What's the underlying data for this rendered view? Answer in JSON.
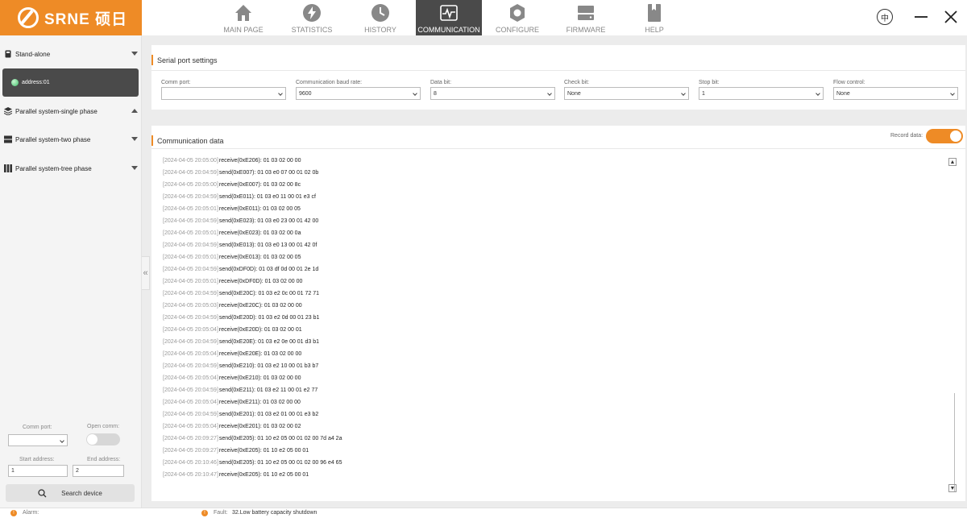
{
  "app": {
    "brand": "SRNE 硕日"
  },
  "nav": [
    {
      "label": "MAIN PAGE",
      "icon": "home-icon"
    },
    {
      "label": "STATISTICS",
      "icon": "bolt-icon"
    },
    {
      "label": "HISTORY",
      "icon": "clock-icon"
    },
    {
      "label": "COMMUNICATION",
      "icon": "pulse-icon",
      "active": true
    },
    {
      "label": "CONFIGURE",
      "icon": "gear-icon"
    },
    {
      "label": "FIRMWARE",
      "icon": "drive-icon"
    },
    {
      "label": "HELP",
      "icon": "book-icon"
    }
  ],
  "window": {
    "lang": "中"
  },
  "sidebar": {
    "items": [
      {
        "label": "Stand-alone"
      },
      {
        "label": "Parallel system-single phase"
      },
      {
        "label": "Parallel system-two phase"
      },
      {
        "label": "Parallel system-tree phase"
      }
    ],
    "address": "address:01",
    "comm_port_label": "Comm port:",
    "comm_port_value": "",
    "open_comm_label": "Open comm:",
    "start_address_label": "Start address:",
    "start_address_value": "1",
    "end_address_label": "End address:",
    "end_address_value": "2",
    "search_label": "Search device"
  },
  "serial": {
    "title": "Serial port settings",
    "fields": [
      {
        "label": "Comm port:",
        "value": ""
      },
      {
        "label": "Communication baud rate:",
        "value": "9600"
      },
      {
        "label": "Data bit:",
        "value": "8"
      },
      {
        "label": "Check bit:",
        "value": "None"
      },
      {
        "label": "Stop bit:",
        "value": "1"
      },
      {
        "label": "Flow control:",
        "value": "None"
      }
    ]
  },
  "comm": {
    "title": "Communication data",
    "record_label": "Record data:",
    "log": [
      {
        "ts": "[2024-04-05 20:05:00]",
        "msg": "receive(0xE206): 01 03 02 00 00"
      },
      {
        "ts": "[2024-04-05 20:04:59]",
        "msg": "send(0xE007): 01 03 e0 07 00 01 02 0b"
      },
      {
        "ts": "[2024-04-05 20:05:00]",
        "msg": "receive(0xE007): 01 03 02 00 8c"
      },
      {
        "ts": "[2024-04-05 20:04:59]",
        "msg": "send(0xE011): 01 03 e0 11 00 01 e3 cf"
      },
      {
        "ts": "[2024-04-05 20:05:01]",
        "msg": "receive(0xE011): 01 03 02 00 05"
      },
      {
        "ts": "[2024-04-05 20:04:59]",
        "msg": "send(0xE023): 01 03 e0 23 00 01 42 00"
      },
      {
        "ts": "[2024-04-05 20:05:01]",
        "msg": "receive(0xE023): 01 03 02 00 0a"
      },
      {
        "ts": "[2024-04-05 20:04:59]",
        "msg": "send(0xE013): 01 03 e0 13 00 01 42 0f"
      },
      {
        "ts": "[2024-04-05 20:05:01]",
        "msg": "receive(0xE013): 01 03 02 00 05"
      },
      {
        "ts": "[2024-04-05 20:04:59]",
        "msg": "send(0xDF0D): 01 03 df 0d 00 01 2e 1d"
      },
      {
        "ts": "[2024-04-05 20:05:01]",
        "msg": "receive(0xDF0D): 01 03 02 00 00"
      },
      {
        "ts": "[2024-04-05 20:04:59]",
        "msg": "send(0xE20C): 01 03 e2 0c 00 01 72 71"
      },
      {
        "ts": "[2024-04-05 20:05:03]",
        "msg": "receive(0xE20C): 01 03 02 00 00"
      },
      {
        "ts": "[2024-04-05 20:04:59]",
        "msg": "send(0xE20D): 01 03 e2 0d 00 01 23 b1"
      },
      {
        "ts": "[2024-04-05 20:05:04]",
        "msg": "receive(0xE20D): 01 03 02 00 01"
      },
      {
        "ts": "[2024-04-05 20:04:59]",
        "msg": "send(0xE20E): 01 03 e2 0e 00 01 d3 b1"
      },
      {
        "ts": "[2024-04-05 20:05:04]",
        "msg": "receive(0xE20E): 01 03 02 00 00"
      },
      {
        "ts": "[2024-04-05 20:04:59]",
        "msg": "send(0xE210): 01 03 e2 10 00 01 b3 b7"
      },
      {
        "ts": "[2024-04-05 20:05:04]",
        "msg": "receive(0xE210): 01 03 02 00 00"
      },
      {
        "ts": "[2024-04-05 20:04:59]",
        "msg": "send(0xE211): 01 03 e2 11 00 01 e2 77"
      },
      {
        "ts": "[2024-04-05 20:05:04]",
        "msg": "receive(0xE211): 01 03 02 00 00"
      },
      {
        "ts": "[2024-04-05 20:04:59]",
        "msg": "send(0xE201): 01 03 e2 01 00 01 e3 b2"
      },
      {
        "ts": "[2024-04-05 20:05:04]",
        "msg": "receive(0xE201): 01 03 02 00 02"
      },
      {
        "ts": "[2024-04-05 20:09:27]",
        "msg": "send(0xE205): 01 10 e2 05 00 01 02 00 7d a4 2a"
      },
      {
        "ts": "[2024-04-05 20:09:27]",
        "msg": "receive(0xE205): 01 10 e2 05 00 01"
      },
      {
        "ts": "[2024-04-05 20:10:46]",
        "msg": "send(0xE205): 01 10 e2 05 00 01 02 00 96 e4 65"
      },
      {
        "ts": "[2024-04-05 20:10:47]",
        "msg": "receive(0xE205): 01 10 e2 05 00 01"
      }
    ]
  },
  "status": {
    "alarm_label": "Alarm:",
    "fault_label": "Fault:",
    "fault_text": "32.Low battery capacity shutdown"
  },
  "colors": {
    "accent": "#ee8b26",
    "active_nav": "#4a4a4a"
  }
}
